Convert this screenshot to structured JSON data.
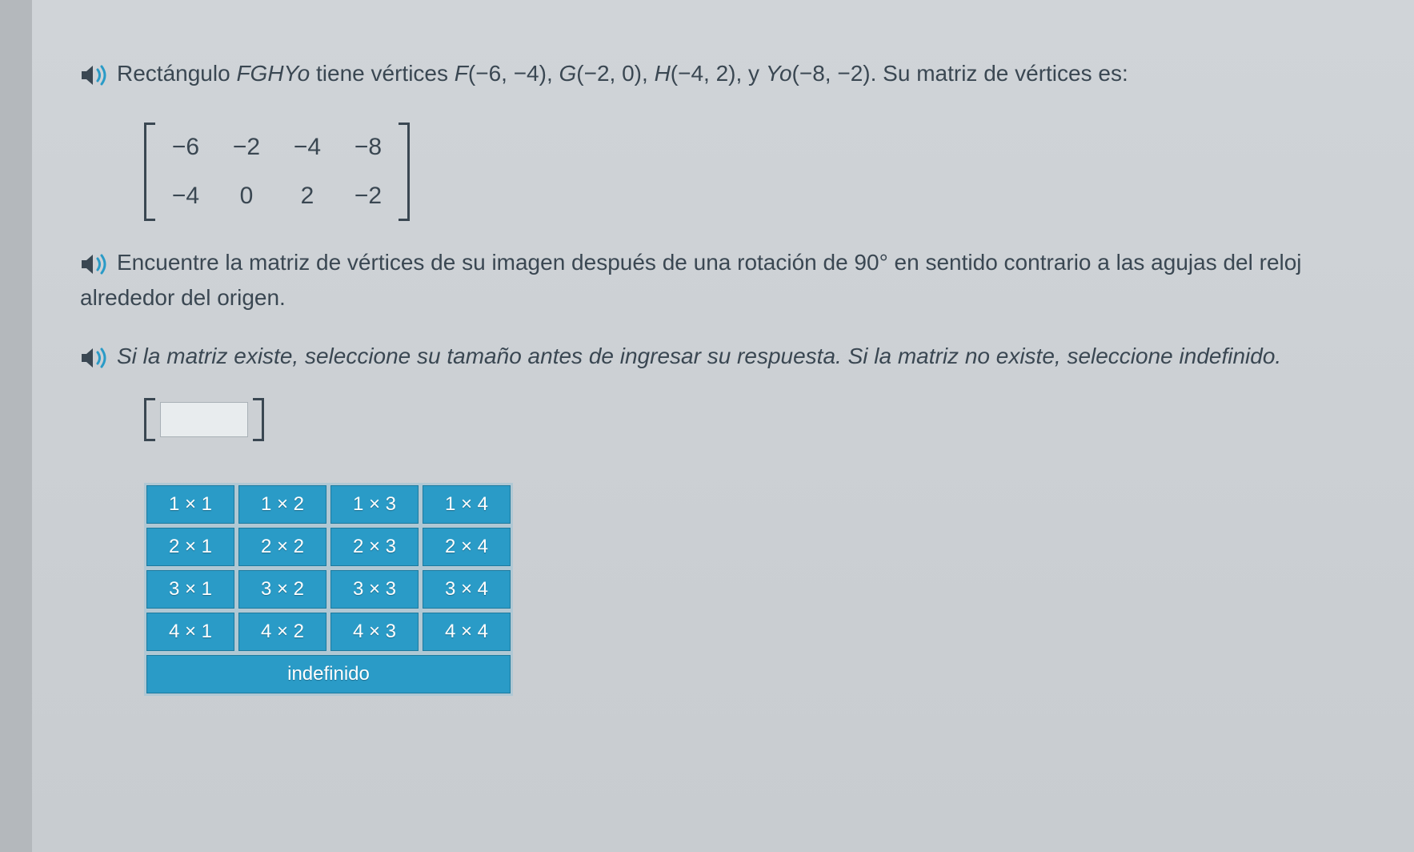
{
  "problem": {
    "line1_prefix": "Rectángulo ",
    "shape_name": "FGHYo",
    "line1_mid": " tiene vértices ",
    "vertex_F_label": "F",
    "vertex_F_coords": "(−6, −4)",
    "sep": ", ",
    "vertex_G_label": "G",
    "vertex_G_coords": "(−2, 0)",
    "vertex_H_label": "H",
    "vertex_H_coords": "(−4, 2)",
    "and": ", y ",
    "vertex_Yo_label": "Yo",
    "vertex_Yo_coords": "(−8, −2)",
    "line1_suffix": ". Su matriz de vértices es:"
  },
  "matrix": {
    "r0c0": "−6",
    "r0c1": "−2",
    "r0c2": "−4",
    "r0c3": "−8",
    "r1c0": "−4",
    "r1c1": "0",
    "r1c2": "2",
    "r1c3": "−2"
  },
  "instruction": {
    "text": "Encuentre la matriz de vértices de su imagen después de una rotación de 90° en sentido contrario a las agujas del reloj alrededor del origen."
  },
  "hint": {
    "text": "Si la matriz existe, seleccione su tamaño antes de ingresar su respuesta. Si la matriz no existe, seleccione indefinido."
  },
  "size_selector": {
    "rows": [
      [
        "1 × 1",
        "1 × 2",
        "1 × 3",
        "1 × 4"
      ],
      [
        "2 × 1",
        "2 × 2",
        "2 × 3",
        "2 × 4"
      ],
      [
        "3 × 1",
        "3 × 2",
        "3 × 3",
        "3 × 4"
      ],
      [
        "4 × 1",
        "4 × 2",
        "4 × 3",
        "4 × 4"
      ]
    ],
    "undefined_label": "indefinido"
  }
}
